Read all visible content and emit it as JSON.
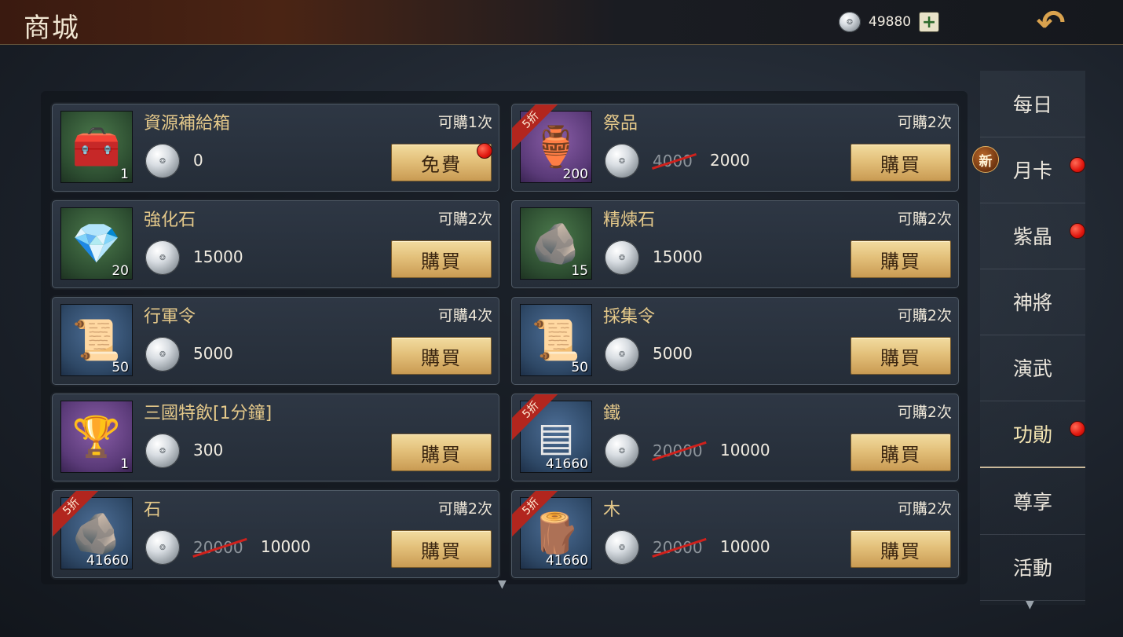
{
  "header": {
    "title": "商城",
    "currency_amount": "49880",
    "currency_icon": "silver-coin-icon",
    "plus_label": "+",
    "back_icon": "back-arrow-icon"
  },
  "colors": {
    "accent_gold": "#e5c98a",
    "button_gold": "#e3c07a",
    "discount_red": "#b2261e",
    "notify_red": "#e0160e"
  },
  "items": [
    {
      "name": "資源補給箱",
      "limit": "可購1次",
      "qty": "1",
      "price": "0",
      "old_price": "",
      "discount": "",
      "button": "免費",
      "icon": "resource-chest-icon",
      "frame": "green",
      "notify": true
    },
    {
      "name": "祭品",
      "limit": "可購2次",
      "qty": "200",
      "price": "2000",
      "old_price": "4000",
      "discount": "5折",
      "button": "購買",
      "icon": "bronze-vessel-icon",
      "frame": "purple",
      "notify": false
    },
    {
      "name": "強化石",
      "limit": "可購2次",
      "qty": "20",
      "price": "15000",
      "old_price": "",
      "discount": "",
      "button": "購買",
      "icon": "enhance-stone-icon",
      "frame": "green",
      "notify": false
    },
    {
      "name": "精煉石",
      "limit": "可購2次",
      "qty": "15",
      "price": "15000",
      "old_price": "",
      "discount": "",
      "button": "購買",
      "icon": "refine-stone-icon",
      "frame": "green",
      "notify": false
    },
    {
      "name": "行軍令",
      "limit": "可購4次",
      "qty": "50",
      "price": "5000",
      "old_price": "",
      "discount": "",
      "button": "購買",
      "icon": "march-token-icon",
      "frame": "blue",
      "notify": false
    },
    {
      "name": "採集令",
      "limit": "可購2次",
      "qty": "50",
      "price": "5000",
      "old_price": "",
      "discount": "",
      "button": "購買",
      "icon": "gather-token-icon",
      "frame": "blue",
      "notify": false
    },
    {
      "name": "三國特飲[1分鐘]",
      "limit": "",
      "qty": "1",
      "price": "300",
      "old_price": "",
      "discount": "",
      "button": "購買",
      "icon": "drink-goblet-icon",
      "frame": "purple",
      "notify": false
    },
    {
      "name": "鐵",
      "limit": "可購2次",
      "qty": "41660",
      "price": "10000",
      "old_price": "20000",
      "discount": "5折",
      "button": "購買",
      "icon": "iron-ingots-icon",
      "frame": "blue",
      "notify": false
    },
    {
      "name": "石",
      "limit": "可購2次",
      "qty": "41660",
      "price": "10000",
      "old_price": "20000",
      "discount": "5折",
      "button": "購買",
      "icon": "stone-pile-icon",
      "frame": "blue",
      "notify": false
    },
    {
      "name": "木",
      "limit": "可購2次",
      "qty": "41660",
      "price": "10000",
      "old_price": "20000",
      "discount": "5折",
      "button": "購買",
      "icon": "wood-logs-icon",
      "frame": "blue",
      "notify": false
    }
  ],
  "sidebar": {
    "new_badge": "新",
    "items": [
      {
        "label": "每日",
        "notify": false,
        "active": false
      },
      {
        "label": "月卡",
        "notify": true,
        "active": false
      },
      {
        "label": "紫晶",
        "notify": true,
        "active": false
      },
      {
        "label": "神將",
        "notify": false,
        "active": false
      },
      {
        "label": "演武",
        "notify": false,
        "active": false
      },
      {
        "label": "功勛",
        "notify": true,
        "active": true
      },
      {
        "label": "尊享",
        "notify": false,
        "active": false
      },
      {
        "label": "活動",
        "notify": false,
        "active": false
      }
    ]
  }
}
